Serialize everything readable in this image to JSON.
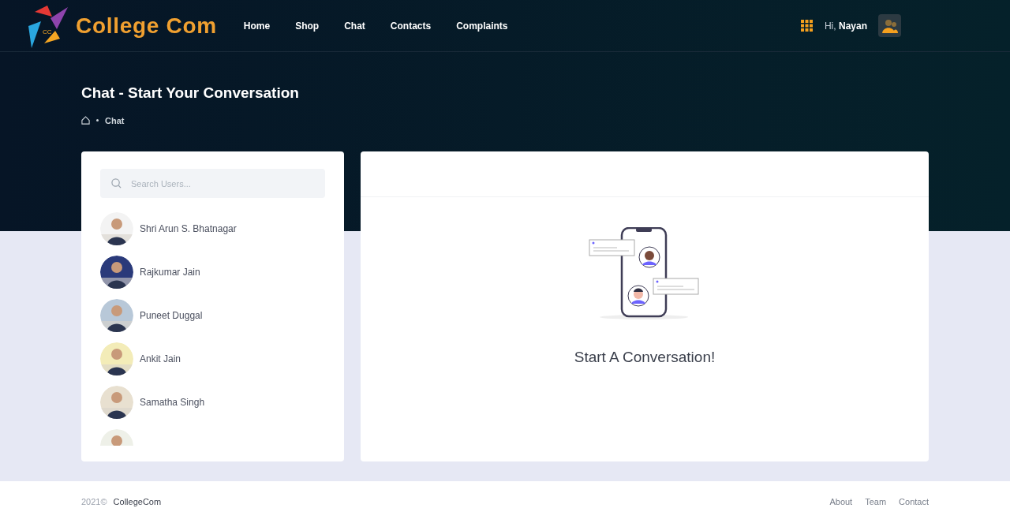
{
  "brand": {
    "name": "College Com",
    "badge": "CC"
  },
  "nav": [
    {
      "label": "Home"
    },
    {
      "label": "Shop"
    },
    {
      "label": "Chat"
    },
    {
      "label": "Contacts"
    },
    {
      "label": "Complaints"
    }
  ],
  "user": {
    "greeting": "Hi,",
    "name": "Nayan"
  },
  "page": {
    "title": "Chat - Start Your Conversation",
    "breadcrumb": "Chat"
  },
  "search": {
    "placeholder": "Search Users..."
  },
  "users": [
    {
      "name": "Shri Arun S. Bhatnagar",
      "kind": "picture"
    },
    {
      "name": "Rajkumar Jain",
      "kind": "picture"
    },
    {
      "name": "Puneet Duggal",
      "kind": "picture"
    },
    {
      "name": "Ankit Jain",
      "kind": "picture"
    },
    {
      "name": "Samatha Singh",
      "kind": "picture"
    },
    {
      "kind": "picture"
    }
  ],
  "empty": {
    "message": "Start A Conversation!"
  },
  "footer": {
    "year": "2021©",
    "site": "CollegeCom",
    "links": [
      {
        "label": "About"
      },
      {
        "label": "Team"
      },
      {
        "label": "Contact"
      }
    ]
  }
}
